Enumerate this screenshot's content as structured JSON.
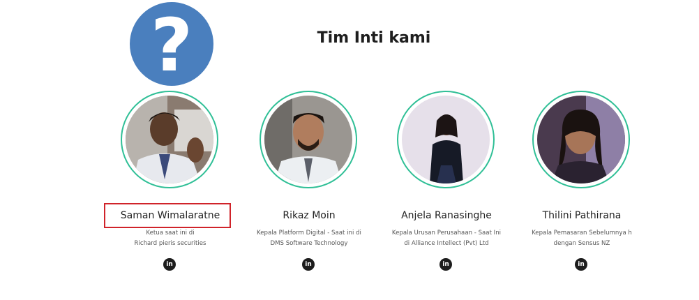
{
  "help_badge": {
    "symbol": "?"
  },
  "section": {
    "title": "Tim Inti kami"
  },
  "team": [
    {
      "name": "Saman Wimalaratne",
      "role_lines": [
        "Ketua saat ini di",
        "Richard pieris securities"
      ],
      "social_icon": "linkedin-icon",
      "social_glyph": "in"
    },
    {
      "name": "Rikaz Moin",
      "role_lines": [
        "Kepala Platform Digital - Saat ini di",
        "DMS Software Technology"
      ],
      "social_icon": "linkedin-icon",
      "social_glyph": "in"
    },
    {
      "name": "Anjela Ranasinghe",
      "role_lines": [
        "Kepala Urusan Perusahaan - Saat Ini",
        "di Alliance Intellect (Pvt) Ltd"
      ],
      "social_icon": "linkedin-icon",
      "social_glyph": "in"
    },
    {
      "name": "Thilini Pathirana",
      "role_lines": [
        "Kepala Pemasaran Sebelumnya  h",
        "dengan Sensus NZ"
      ],
      "social_icon": "linkedin-icon",
      "social_glyph": "in"
    }
  ],
  "colors": {
    "accent_ring": "#2fbf96",
    "highlight": "#d0232a",
    "help_badge": "#4a7fbe"
  }
}
